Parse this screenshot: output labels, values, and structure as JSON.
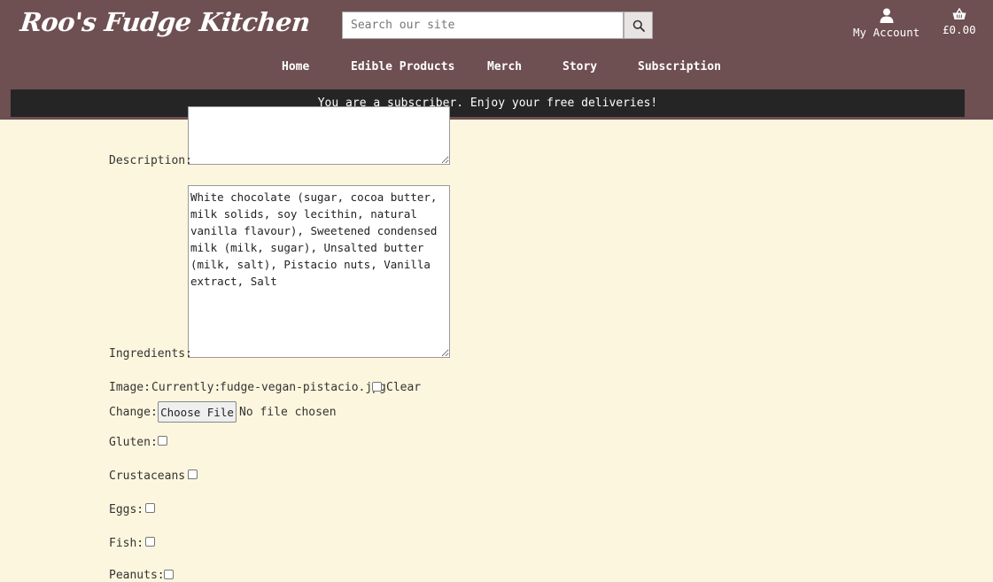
{
  "header": {
    "logo": "Roo's Fudge Kitchen",
    "search_placeholder": "Search our site",
    "account_label": "My Account",
    "basket_total": "£0.00"
  },
  "nav": [
    "Home",
    "Edible Products",
    "Merch",
    "Story",
    "Subscription"
  ],
  "banner": "You are a subscriber. Enjoy your free deliveries!",
  "form": {
    "description_label": "Description:",
    "description_value": "",
    "ingredients_label": "Ingredients:",
    "ingredients_value": "White chocolate (sugar, cocoa butter, milk solids, soy lecithin, natural vanilla flavour), Sweetened condensed milk (milk, sugar), Unsalted butter (milk, salt), Pistacio nuts, Vanilla extract, Salt",
    "image_label": "Image:",
    "image_currently_label": "Currently:",
    "image_filename": "fudge-vegan-pistacio.jpg",
    "image_clear_label": "Clear",
    "image_change_label": "Change:",
    "file_button": "Choose File",
    "file_status": "No file chosen",
    "allergens": [
      {
        "label": "Gluten:",
        "checked": false
      },
      {
        "label": "Crustaceans:",
        "checked": false
      },
      {
        "label": "Eggs:",
        "checked": false
      },
      {
        "label": "Fish:",
        "checked": false
      },
      {
        "label": "Peanuts:",
        "checked": false
      }
    ]
  }
}
